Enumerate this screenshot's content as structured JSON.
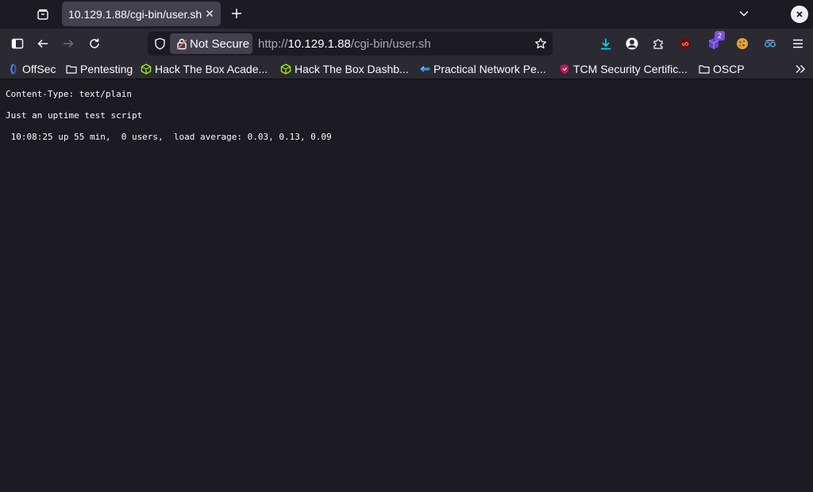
{
  "tabs": [
    {
      "title": "10.129.1.88/cgi-bin/user.sh",
      "active": true
    }
  ],
  "navbar": {
    "security_label": "Not Secure",
    "url": {
      "scheme": "http://",
      "host": "10.129.1.88",
      "path": "/cgi-bin/user.sh"
    },
    "extensions": [
      {
        "icon": "download-icon"
      },
      {
        "icon": "account-icon"
      },
      {
        "icon": "extensions-puzzle-icon"
      },
      {
        "icon": "ublock-origin-icon"
      },
      {
        "icon": "purple-extension-icon",
        "badge": "2"
      },
      {
        "icon": "cookie-extension-icon"
      },
      {
        "icon": "spy-glasses-icon"
      },
      {
        "icon": "hamburger-menu-icon"
      }
    ]
  },
  "bookmarks": [
    {
      "label": "OffSec",
      "icon": "offsec-icon"
    },
    {
      "label": "Pentesting",
      "icon": "folder-icon"
    },
    {
      "label": "Hack The Box Acade...",
      "icon": "htb-cube-icon"
    },
    {
      "label": "Hack The Box Dashb...",
      "icon": "htb-cube-icon"
    },
    {
      "label": "Practical Network Pe...",
      "icon": "tcm-icon"
    },
    {
      "label": "TCM Security Certific...",
      "icon": "tcm-shield-icon"
    },
    {
      "label": "OSCP",
      "icon": "folder-icon"
    }
  ],
  "colors": {
    "htb_green": "#9fef00",
    "background": "#1c1b22",
    "toolbar": "#2b2a33",
    "download_blue": "#00ddff"
  },
  "content": {
    "lines": [
      "Content-Type: text/plain",
      "Just an uptime test script",
      " 10:08:25 up 55 min,  0 users,  load average: 0.03, 0.13, 0.09"
    ]
  }
}
